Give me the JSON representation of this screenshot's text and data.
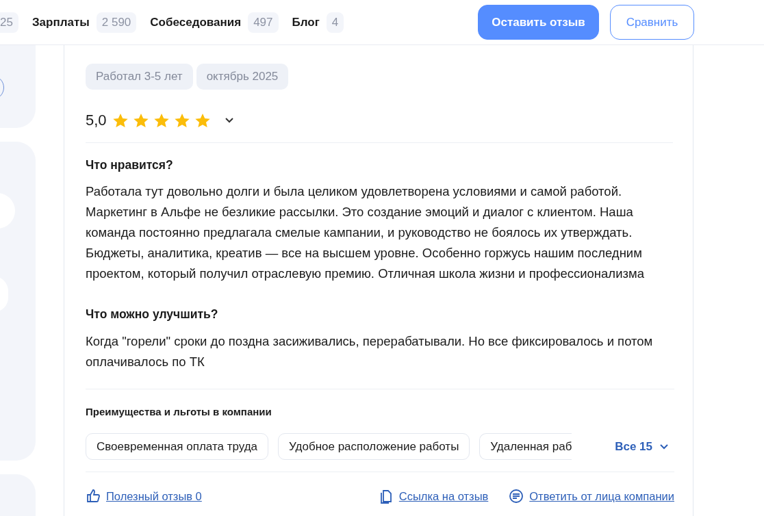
{
  "header": {
    "tabs": [
      {
        "count": "25"
      },
      {
        "label": "Зарплаты",
        "count": "2 590"
      },
      {
        "label": "Собеседования",
        "count": "497"
      },
      {
        "label": "Блог",
        "count": "4"
      }
    ],
    "buttons": [
      {
        "kind": "primary",
        "label": "Оставить отзыв"
      },
      {
        "kind": "outline",
        "label": "Сравнить"
      }
    ]
  },
  "review": {
    "tags": [
      "Работал 3-5 лет",
      "октябрь 2025"
    ],
    "rating": "5,0",
    "stars": 5,
    "sections": [
      {
        "heading": "Что нравится?",
        "text": "Работала тут довольно долги и была целиком удовлетворена условиями и самой работой. Маркетинг в Альфе не безликие рассылки. Это создание эмоций и диалог с клиентом. Наша команда постоянно предлагала смелые кампании, и руководство не боялось их утверждать. Бюджеты, аналитика, креатив — все на высшем уровне. Особенно горжусь нашим последним проектом, который получил отраслевую премию. Отличная школа жизни и профессионализма"
      },
      {
        "heading": "Что можно улучшить?",
        "text": "Когда \"горели\" сроки до поздна засиживались, перерабатывали. Но все фиксировалось и потом оплачивалось по ТК"
      }
    ],
    "benefits": {
      "title": "Преимущества и льготы в компании",
      "items": [
        "Своевременная оплата труда",
        "Удобное расположение работы",
        "Удаленная раб"
      ],
      "more": "Все 15"
    },
    "actions": [
      {
        "kind": "like",
        "label": "Полезный отзыв 0"
      },
      {
        "kind": "link",
        "label": "Ссылка на отзыв"
      },
      {
        "kind": "reply",
        "label": "Ответить от лица компании"
      }
    ]
  }
}
